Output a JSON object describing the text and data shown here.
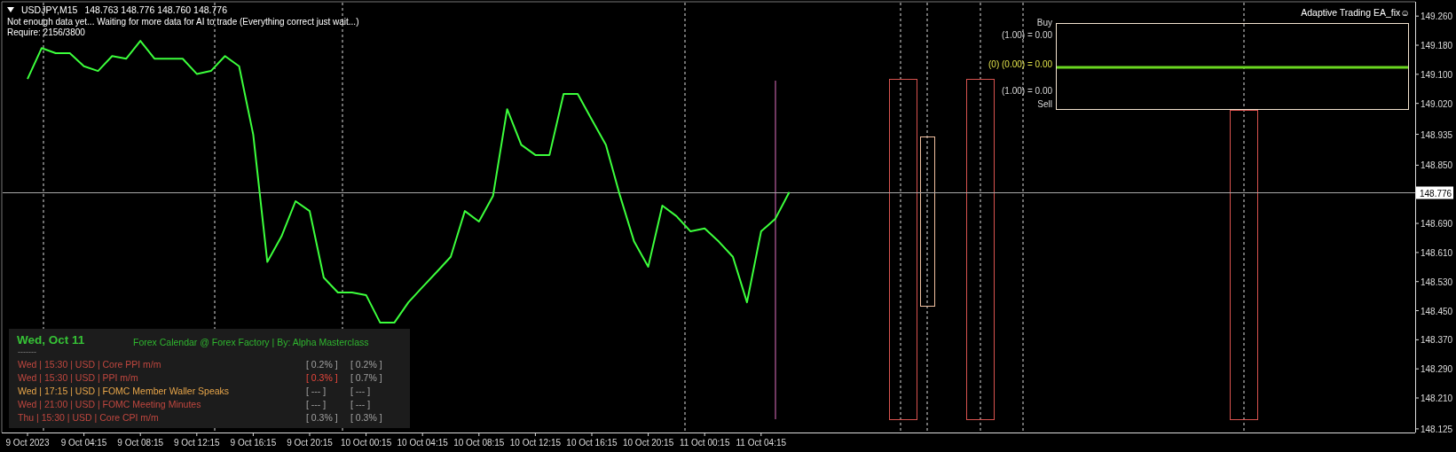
{
  "header": {
    "symbol": "USDJPY,M15",
    "quote": "148.763 148.776 148.760 148.776",
    "status_lines": [
      "Not enough data yet... Waiting for more data for AI to trade (Everything correct just wait...)",
      "Require: 2156/3800"
    ]
  },
  "chart": {
    "chart_data": {
      "type": "line",
      "grid": true,
      "categories": [
        "9 Oct 2023",
        null,
        null,
        null,
        "9 Oct 04:15",
        null,
        null,
        null,
        "9 Oct 08:15",
        null,
        null,
        null,
        "9 Oct 12:15",
        null,
        null,
        null,
        "9 Oct 16:15",
        null,
        null,
        null,
        "9 Oct 20:15",
        null,
        null,
        null,
        "10 Oct 00:15",
        null,
        null,
        null,
        "10 Oct 04:15",
        null,
        null,
        null,
        "10 Oct 08:15",
        null,
        null,
        null,
        "10 Oct 12:15",
        null,
        null,
        null,
        "10 Oct 16:15",
        null,
        null,
        null,
        "10 Oct 20:15",
        null,
        null,
        null,
        "11 Oct 00:15",
        null,
        null,
        null,
        "11 Oct 04:15",
        null,
        null
      ],
      "ylim": [
        148.115,
        149.297
      ],
      "series": [
        {
          "color": "#3cff3c",
          "values": [
            149.087,
            149.172,
            149.158,
            149.158,
            149.122,
            149.109,
            149.15,
            149.143,
            149.192,
            149.143,
            149.143,
            149.143,
            149.101,
            149.109,
            149.15,
            149.122,
            148.934,
            148.584,
            148.654,
            148.751,
            148.724,
            148.541,
            148.5,
            148.5,
            148.493,
            148.417,
            148.417,
            148.473,
            148.515,
            148.556,
            148.598,
            148.724,
            148.695,
            148.766,
            149.004,
            148.906,
            148.878,
            148.878,
            149.046,
            149.046,
            148.975,
            148.906,
            148.766,
            148.64,
            148.571,
            148.739,
            148.71,
            148.668,
            148.676,
            148.64,
            148.598,
            148.473,
            148.668,
            148.702,
            148.776
          ]
        }
      ],
      "yticks": [
        {
          "value": 149.26,
          "label": "149.260"
        },
        {
          "value": 149.18,
          "label": "149.180"
        },
        {
          "value": 149.1,
          "label": "149.100"
        },
        {
          "value": 149.02,
          "label": "149.020"
        },
        {
          "value": 148.935,
          "label": "148.935"
        },
        {
          "value": 148.85,
          "label": "148.850"
        },
        {
          "value": 148.69,
          "label": "148.690"
        },
        {
          "value": 148.61,
          "label": "148.610"
        },
        {
          "value": 148.53,
          "label": "148.530"
        },
        {
          "value": 148.45,
          "label": "148.450"
        },
        {
          "value": 148.37,
          "label": "148.370"
        },
        {
          "value": 148.29,
          "label": "148.290"
        },
        {
          "value": 148.21,
          "label": "148.210"
        },
        {
          "value": 148.125,
          "label": "148.125"
        }
      ],
      "ref_lines": [
        {
          "axis": "y",
          "value": 148.776,
          "label": "148.776"
        }
      ]
    }
  },
  "signal_panel": {
    "title": "Adaptive Trading EA_fix☺",
    "buy_label": "Buy",
    "sell_label": "Sell",
    "levels": [
      {
        "kind": "buy",
        "text": "(1.00) = 0.00"
      },
      {
        "kind": "current",
        "text": "(0) (0.00) = 0.00"
      },
      {
        "kind": "sell",
        "text": "(1.00) = 0.00"
      }
    ]
  },
  "calendar": {
    "date": "Wed, Oct 11",
    "source": "Forex Calendar @ Forex Factory | By: Alpha Masterclass",
    "divider": "-------",
    "events": [
      {
        "text": "Wed  |  15:30  |  USD  |  Core PPI m/m",
        "color": "#c0473f",
        "value_1": "[ 0.2% ]",
        "value_1_highlighted": false,
        "value_2": "[ 0.2% ]"
      },
      {
        "text": "Wed  |  15:30  |  USD  |  PPI m/m",
        "color": "#c0473f",
        "value_1": "[ 0.3% ]",
        "value_1_highlighted": true,
        "value_2": "[ 0.7% ]"
      },
      {
        "text": "Wed  |  17:15  |  USD  |  FOMC Member Waller Speaks",
        "color": "#e8a64a",
        "value_1": "[ --- ]",
        "value_1_highlighted": false,
        "value_2": "[ --- ]"
      },
      {
        "text": "Wed  |  21:00  |  USD  |  FOMC Meeting Minutes",
        "color": "#c0473f",
        "value_1": "[ --- ]",
        "value_1_highlighted": false,
        "value_2": "[ --- ]"
      },
      {
        "text": "Thu  |  15:30  |  USD  |  Core CPI m/m",
        "color": "#c0473f",
        "value_1": "[ 0.3% ]",
        "value_1_highlighted": false,
        "value_2": "[ 0.3% ]"
      }
    ]
  }
}
